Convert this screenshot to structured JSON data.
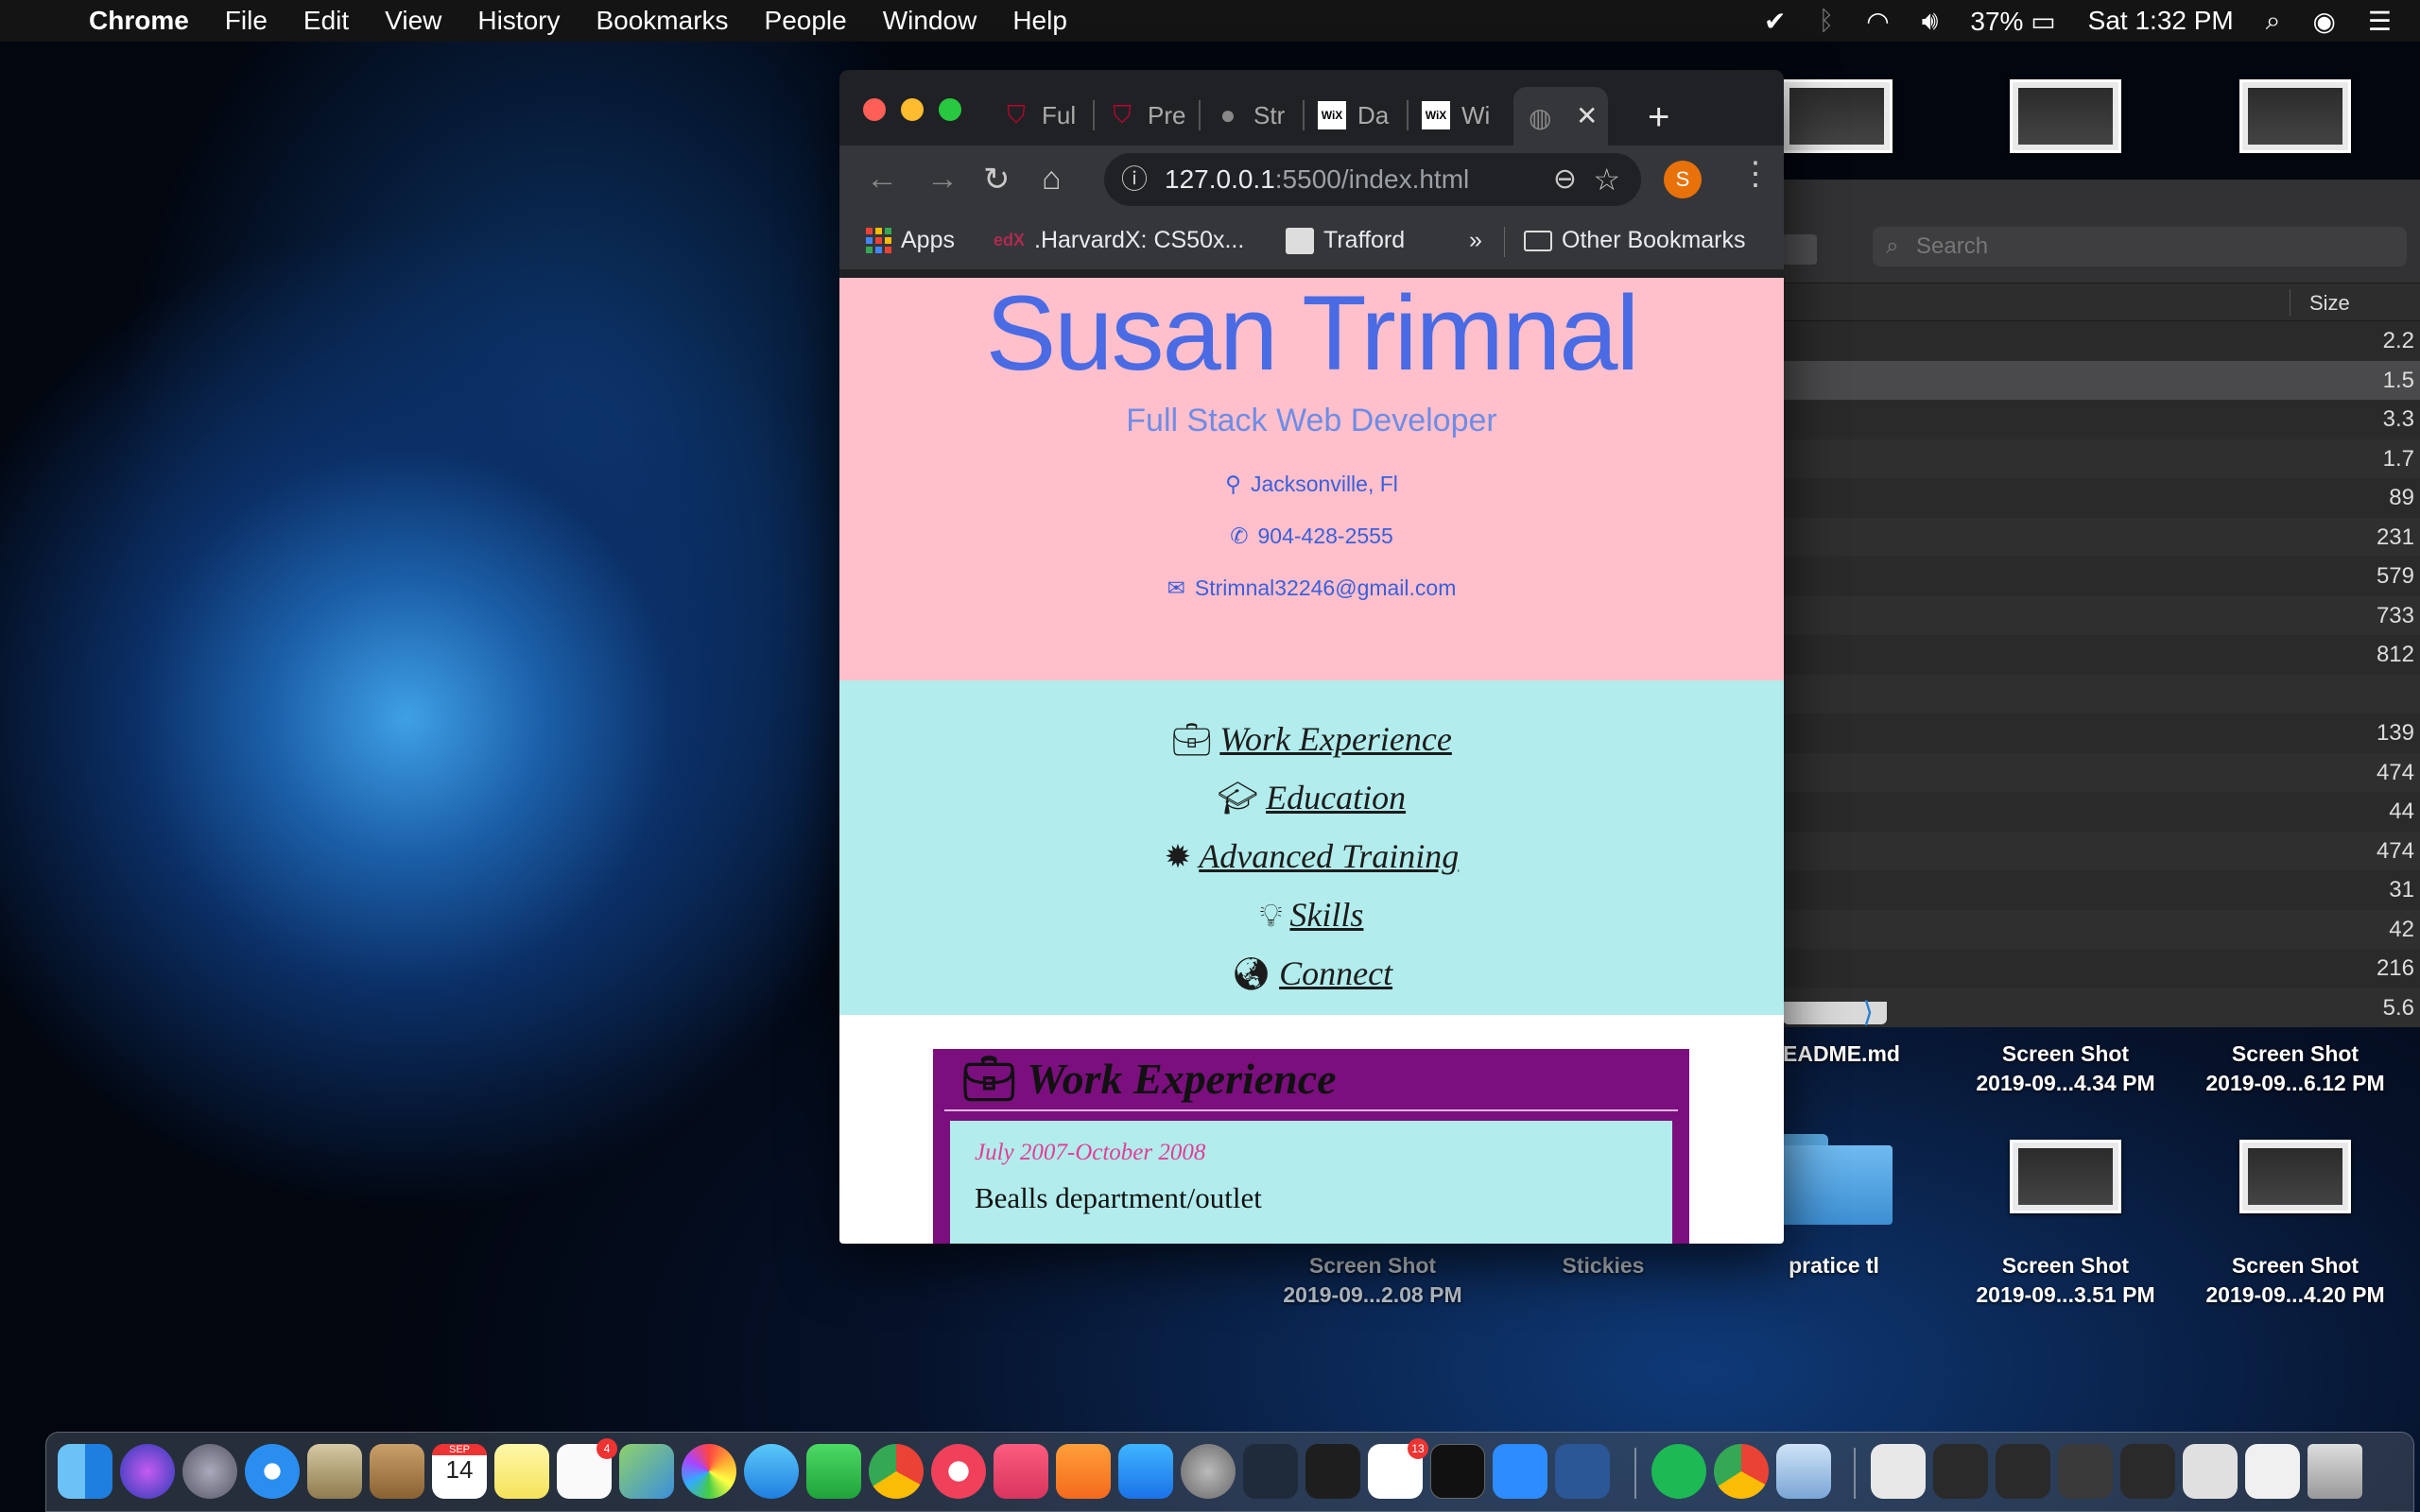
{
  "menubar": {
    "app": "Chrome",
    "items": [
      "File",
      "Edit",
      "View",
      "History",
      "Bookmarks",
      "People",
      "Window",
      "Help"
    ],
    "battery": "37%",
    "clock": "Sat 1:32 PM"
  },
  "finder": {
    "search_placeholder": "Search",
    "size_header": "Size",
    "sizes": [
      "2.2",
      "1.5",
      "3.3",
      "1.7",
      "89",
      "231",
      "579",
      "733",
      "812",
      "",
      "139",
      "474",
      "44",
      "474",
      "31",
      "42",
      "216",
      "5.6"
    ]
  },
  "desktop": {
    "items": [
      {
        "label": "EADME.md"
      },
      {
        "label1": "Screen Shot",
        "label2": "2019-09...4.34 PM"
      },
      {
        "label1": "Screen Shot",
        "label2": "2019-09...6.12 PM"
      },
      {
        "label1": "Screen Shot",
        "label2": "2019-09...2.08 PM"
      },
      {
        "label": "Stickies"
      },
      {
        "label": "pratice tl"
      },
      {
        "label1": "Screen Shot",
        "label2": "2019-09...3.51 PM"
      },
      {
        "label1": "Screen Shot",
        "label2": "2019-09...4.20 PM"
      }
    ]
  },
  "browser": {
    "tabs": [
      "Ful",
      "Pre",
      "Str",
      "Da",
      "Wi"
    ],
    "url_host": "127.0.0.1",
    "url_path": ":5500/index.html",
    "profile_initial": "S",
    "bookmarks": {
      "apps": "Apps",
      "b1": ".HarvardX: CS50x...",
      "b2": "Trafford",
      "more": "»",
      "other": "Other Bookmarks",
      "edx": "edX"
    }
  },
  "page": {
    "name": "Susan Trimnal",
    "title": "Full Stack Web Developer",
    "location": "Jacksonville, Fl",
    "phone": "904-428-2555",
    "email": "Strimnal32246@gmail.com",
    "nav": [
      "Work Experience",
      "Education",
      "Advanced Training",
      "Skills",
      "Connect"
    ],
    "work_heading": "Work Experience",
    "job": {
      "date": "July 2007-October 2008",
      "company": "Bealls department/outlet"
    }
  },
  "dock": {
    "calendar_month": "SEP",
    "calendar_day": "14",
    "reminders_badge": "4",
    "slack_badge": "13"
  }
}
